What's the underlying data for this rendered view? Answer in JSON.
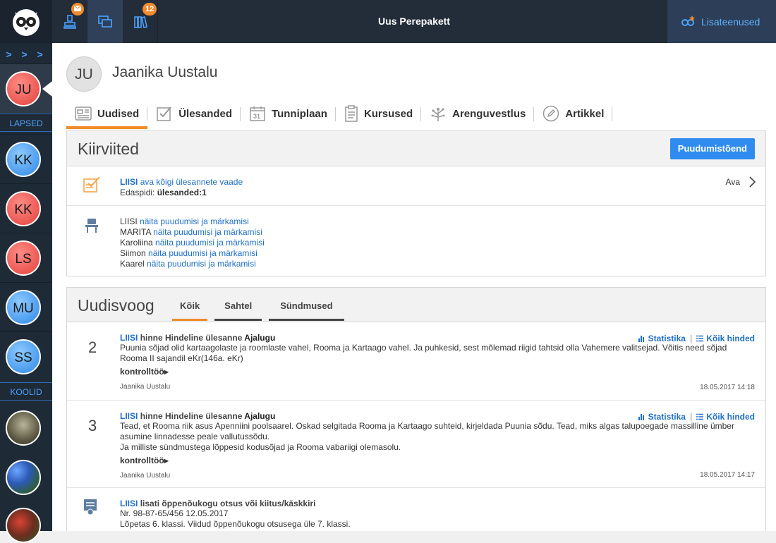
{
  "topbar": {
    "title": "Uus Perepakett",
    "mail_badge": "",
    "books_badge": "12",
    "extra_label": "Lisateenused"
  },
  "sidebar": {
    "chevrons": "> > >",
    "section_children": "LAPSED",
    "section_schools": "KOOLID",
    "children": [
      {
        "initials": "JU",
        "color": "red",
        "active": true
      },
      {
        "initials": "KK",
        "color": "blue"
      },
      {
        "initials": "KK",
        "color": "red"
      },
      {
        "initials": "LS",
        "color": "red"
      },
      {
        "initials": "MU",
        "color": "blue"
      },
      {
        "initials": "SS",
        "color": "blue"
      }
    ]
  },
  "user": {
    "initials": "JU",
    "name": "Jaanika Uustalu"
  },
  "tabs": [
    {
      "label": "Uudised",
      "icon": "news-icon",
      "active": true
    },
    {
      "label": "Ülesanded",
      "icon": "checkbox-icon"
    },
    {
      "label": "Tunniplaan",
      "icon": "calendar-icon"
    },
    {
      "label": "Kursused",
      "icon": "clipboard-icon"
    },
    {
      "label": "Arenguvestlus",
      "icon": "tree-icon"
    },
    {
      "label": "Artikkel",
      "icon": "pencil-icon"
    }
  ],
  "kiirviited": {
    "title": "Kiirviited",
    "button": "Puudumistõend",
    "tasks": {
      "name": "LIISI",
      "link": "ava kõigi ülesannete vaade",
      "future_label": "Edaspidi:",
      "future_value": "ülesanded:1",
      "open": "Ava"
    },
    "absences": [
      {
        "name": "LIISI",
        "link": "näita puudumisi ja märkamisi"
      },
      {
        "name": "MARITA",
        "link": "näita puudumisi ja märkamisi"
      },
      {
        "name": "Karoliina",
        "link": "näita puudumisi ja märkamisi"
      },
      {
        "name": "Siimon",
        "link": "näita puudumisi ja märkamisi"
      },
      {
        "name": "Kaarel",
        "link": "näita puudumisi ja märkamisi"
      }
    ]
  },
  "uudisvoog": {
    "title": "Uudisvoog",
    "filters": [
      "Kõik",
      "Sahtel",
      "Sündmused"
    ],
    "stats_label": "Statistika",
    "grades_label": "Kõik hinded",
    "items": [
      {
        "grade": "2",
        "name": "LIISI",
        "title_mid": "hinne Hindeline ülesanne",
        "subject": "Ajalugu",
        "text1": "Puunia sõjad olid kartaagolaste ja roomlaste vahel, Rooma ja Kartaago vahel. Ja puhkesid, sest mõlemad riigid tahtsid olla Vahemere valitsejad. Võitis need sõjad",
        "text2": "Rooma II sajandil eKr(146a. eKr)",
        "text3": "",
        "type": "kontrolltöö",
        "author": "Jaanika Uustalu",
        "date": "18.05.2017 14:18"
      },
      {
        "grade": "3",
        "name": "LIISI",
        "title_mid": "hinne Hindeline ülesanne",
        "subject": "Ajalugu",
        "text1": "Tead, et Rooma riik asus Apenniini poolsaarel. Oskad selgitada Rooma ja Kartaago suhteid, kirjeldada Puunia sõdu. Tead, miks algas talupoegade massilline ümber",
        "text2": "asumine linnadesse peale vallutussõdu.",
        "text3": "Ja milliste sündmustega lõppesid kodusõjad ja Rooma vabariigi olemasolu.",
        "type": "kontrolltöö",
        "author": "Jaanika Uustalu",
        "date": "18.05.2017 14:17"
      }
    ],
    "decision": {
      "name": "LIISI",
      "title": "lisati õppenõukogu otsus või kiitus/käskkiri",
      "line1": "Nr. 98-87-65/456 12.05.2017",
      "line2": "Lõpetas 6. klassi. Viidud õppenõukogu otsusega üle 7. klassi."
    }
  }
}
